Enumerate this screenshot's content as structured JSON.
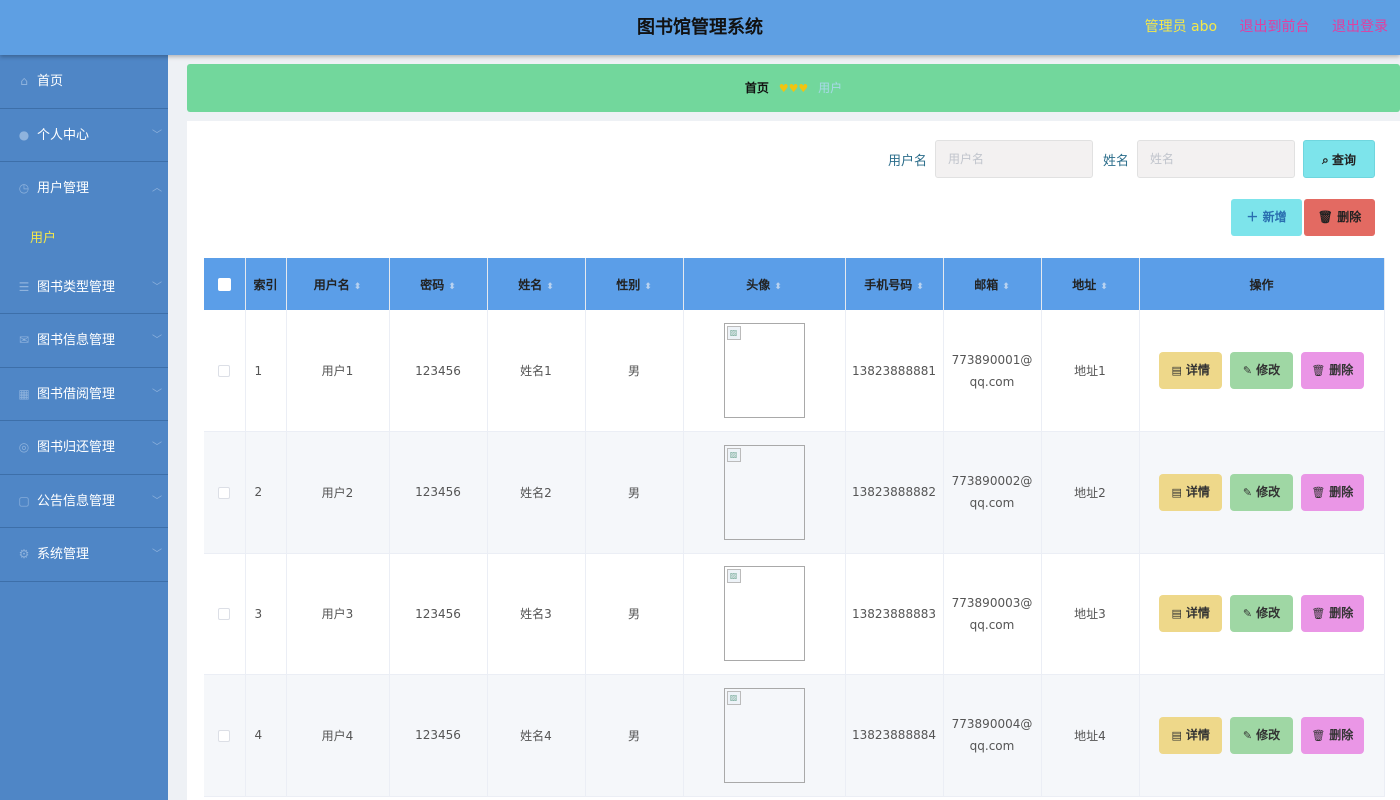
{
  "header": {
    "title": "图书馆管理系统",
    "admin_label": "管理员 abo",
    "to_front": "退出到前台",
    "logout": "退出登录"
  },
  "sidebar": {
    "items": [
      {
        "label": "首页",
        "icon": "home-icon"
      },
      {
        "label": "个人中心",
        "icon": "user-icon"
      },
      {
        "label": "用户管理",
        "icon": "clock-icon"
      },
      {
        "label": "图书类型管理",
        "icon": "list-icon"
      },
      {
        "label": "图书信息管理",
        "icon": "mail-icon"
      },
      {
        "label": "图书借阅管理",
        "icon": "grid-icon"
      },
      {
        "label": "图书归还管理",
        "icon": "compass-icon"
      },
      {
        "label": "公告信息管理",
        "icon": "message-icon"
      },
      {
        "label": "系统管理",
        "icon": "settings-icon"
      }
    ],
    "submenu_active": "用户"
  },
  "breadcrumb": {
    "home": "首页",
    "separator": "♥♥♥",
    "current": "用户"
  },
  "search": {
    "username_label": "用户名",
    "username_placeholder": "用户名",
    "name_label": "姓名",
    "name_placeholder": "姓名",
    "query_button": "查询"
  },
  "actions": {
    "add_button": "新增",
    "delete_button": "删除"
  },
  "table": {
    "headers": {
      "index": "索引",
      "username": "用户名",
      "password": "密码",
      "name": "姓名",
      "gender": "性别",
      "avatar": "头像",
      "phone": "手机号码",
      "email": "邮箱",
      "address": "地址",
      "operation": "操作"
    },
    "rows": [
      {
        "index": "1",
        "username": "用户1",
        "password": "123456",
        "name": "姓名1",
        "gender": "男",
        "phone": "13823888881",
        "email": "773890001@qq.com",
        "address": "地址1"
      },
      {
        "index": "2",
        "username": "用户2",
        "password": "123456",
        "name": "姓名2",
        "gender": "男",
        "phone": "13823888882",
        "email": "773890002@qq.com",
        "address": "地址2"
      },
      {
        "index": "3",
        "username": "用户3",
        "password": "123456",
        "name": "姓名3",
        "gender": "男",
        "phone": "13823888883",
        "email": "773890003@qq.com",
        "address": "地址3"
      },
      {
        "index": "4",
        "username": "用户4",
        "password": "123456",
        "name": "姓名4",
        "gender": "男",
        "phone": "13823888884",
        "email": "773890004@qq.com",
        "address": "地址4"
      }
    ],
    "op_detail": "详情",
    "op_edit": "修改",
    "op_delete": "删除"
  },
  "colors": {
    "topbar": "#5e9fe3",
    "sidebar": "#4f86c6",
    "breadcrumb": "#72d79c",
    "table_header": "#5b9ee8",
    "admin_text": "#f4e84a",
    "link_text": "#e040a0"
  }
}
